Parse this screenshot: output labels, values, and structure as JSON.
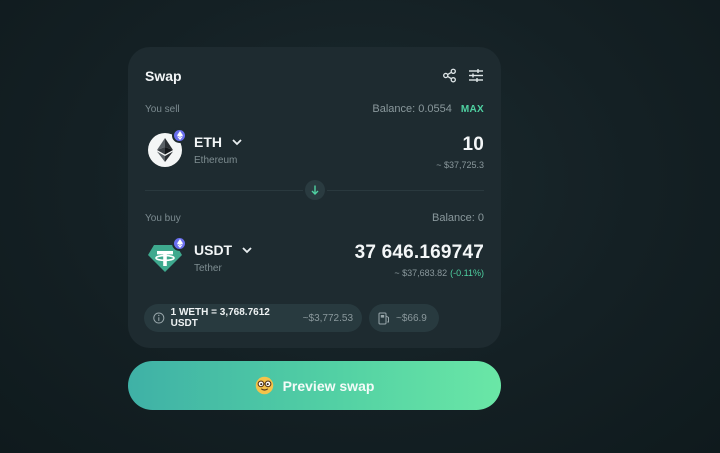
{
  "swap": {
    "title": "Swap",
    "icons": {
      "share": "share-icon",
      "settings": "sliders-icon"
    }
  },
  "sell": {
    "label": "You sell",
    "balance": "Balance: 0.0554",
    "max_label": "MAX",
    "token_symbol": "ETH",
    "token_name": "Ethereum",
    "amount": "10",
    "amount_usd": "~ $37,725.3"
  },
  "buy": {
    "label": "You buy",
    "balance": "Balance: 0",
    "token_symbol": "USDT",
    "token_name": "Tether",
    "amount": "37 646.169747",
    "amount_usd": "~ $37,683.82",
    "price_impact": "(-0.11%)"
  },
  "rate": {
    "text": "1 WETH = 3,768.7612 USDT",
    "usd": "~$3,772.53"
  },
  "gas": {
    "text": "~$66.9"
  },
  "cta": {
    "label": "Preview swap"
  },
  "colors": {
    "accent": "#4fd2a2",
    "card": "#1e2b30",
    "pill": "#283a3f",
    "badge": "#6a6ff0",
    "tether": "#3ea98e"
  }
}
